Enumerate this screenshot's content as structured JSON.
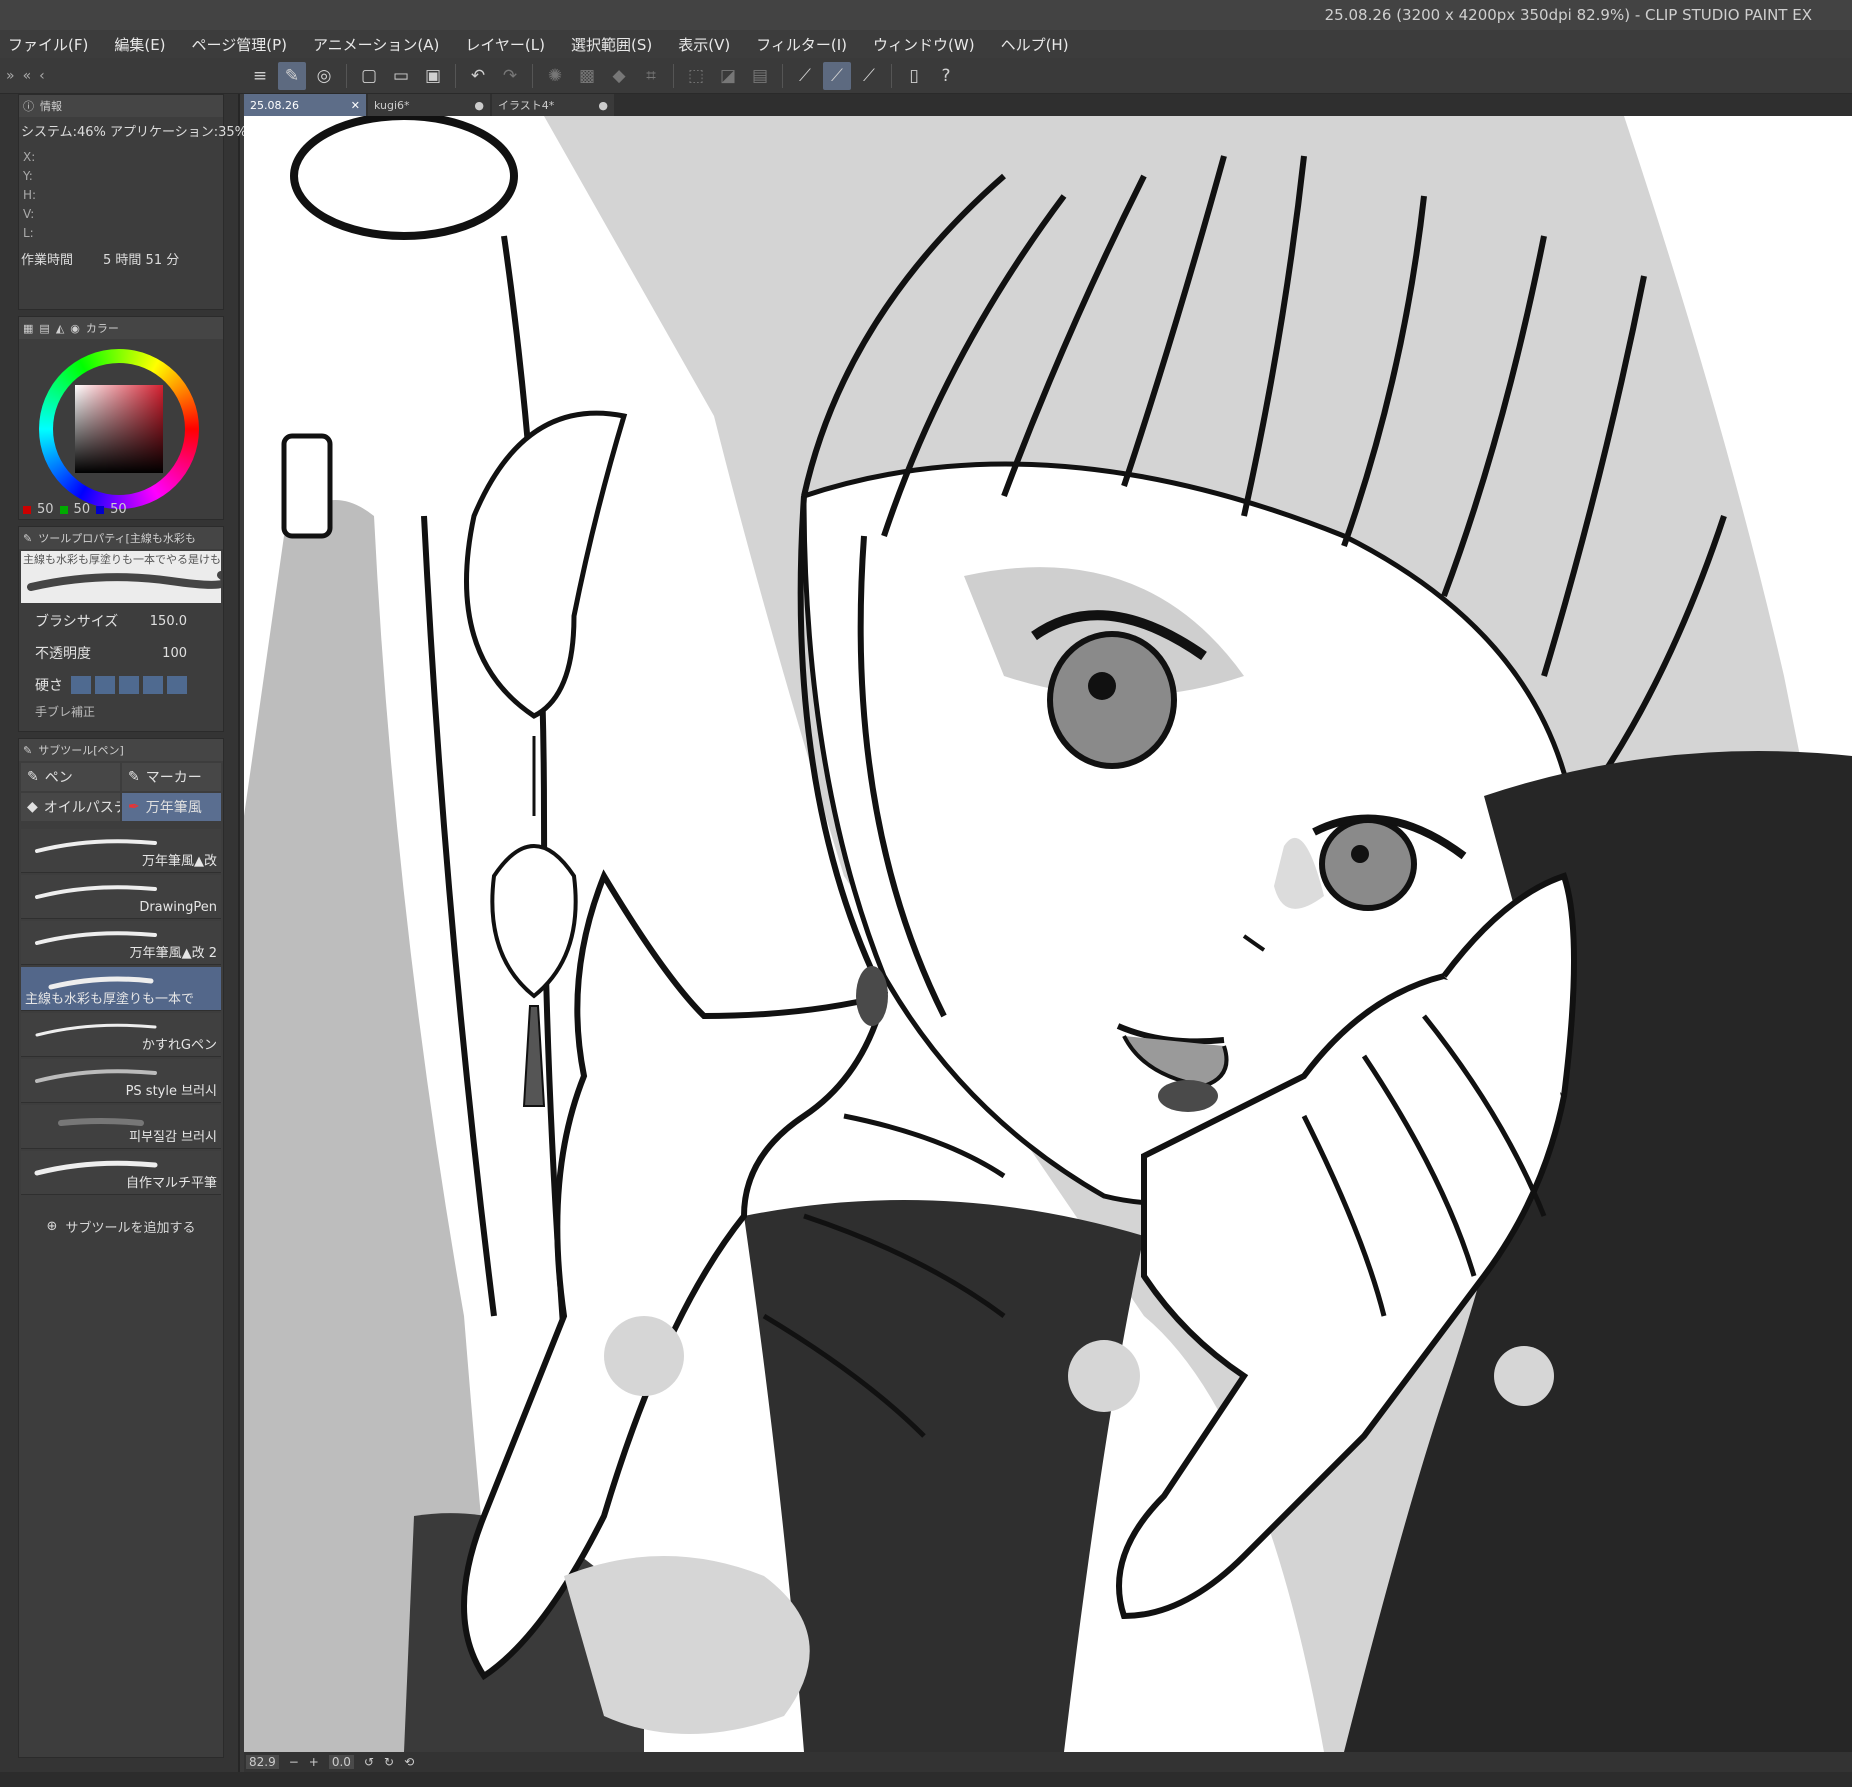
{
  "window": {
    "title": "25.08.26 (3200 x 4200px 350dpi 82.9%)  - CLIP STUDIO PAINT EX"
  },
  "menu": [
    "ファイル(F)",
    "編集(E)",
    "ページ管理(P)",
    "アニメーション(A)",
    "レイヤー(L)",
    "選択範囲(S)",
    "表示(V)",
    "フィルター(I)",
    "ウィンドウ(W)",
    "ヘルプ(H)"
  ],
  "info": {
    "tab": "情報",
    "system_label": "システム:46%  アプリケーション:35%",
    "coords": [
      "X:",
      "Y:",
      "H:",
      "V:",
      "L:"
    ],
    "work_time_label": "作業時間",
    "work_time_value": "5 時間 51 分"
  },
  "color": {
    "tab": "カラー",
    "r": "50",
    "g": "50",
    "b": "50",
    "main_color": "#d42030"
  },
  "tool_property": {
    "tab": "ツールプロパティ[主線も水彩も",
    "preview_text": "主線も水彩も厚塗りも一本でやる是けものブ",
    "brush_size_label": "ブラシサイズ",
    "brush_size_value": "150.0",
    "opacity_label": "不透明度",
    "opacity_value": "100",
    "hardness_label": "硬さ",
    "stabilization_label": "手ブレ補正"
  },
  "subtool": {
    "tab": "サブツール[ペン]",
    "groups": [
      {
        "label": "ペン",
        "active": false
      },
      {
        "label": "マーカー",
        "active": false
      },
      {
        "label": "オイルパステ",
        "active": false
      },
      {
        "label": "万年筆風",
        "active": true
      }
    ],
    "brushes": [
      {
        "name": "万年筆風▲改",
        "selected": false
      },
      {
        "name": "DrawingPen",
        "selected": false
      },
      {
        "name": "万年筆風▲改 2",
        "selected": false
      },
      {
        "name": "主線も水彩も厚塗りも一本で",
        "selected": true
      },
      {
        "name": "かすれGペン",
        "selected": false
      },
      {
        "name": "PS style 브러시",
        "selected": false
      },
      {
        "name": "피부질감 브러시",
        "selected": false
      },
      {
        "name": "自作マルチ平筆",
        "selected": false
      }
    ],
    "add_label": "サブツールを追加する"
  },
  "doc_tabs": [
    {
      "label": "25.08.26",
      "active": true,
      "close": "✕"
    },
    {
      "label": "kugi6*",
      "active": false,
      "close": "●"
    },
    {
      "label": "イラスト4*",
      "active": false,
      "close": "●"
    }
  ],
  "status": {
    "zoom": "82.9",
    "angle": "0.0"
  }
}
